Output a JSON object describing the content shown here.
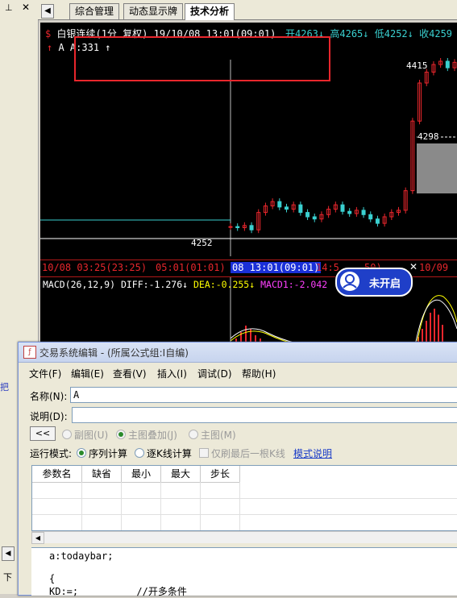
{
  "left_panel": {
    "pin_icon": "pin-icon",
    "close_label": "✕",
    "partial_char": "把",
    "arrow_label": "◀",
    "partial_char2": "下"
  },
  "tabs": {
    "nav_label": "◀",
    "items": [
      {
        "label": "综合管理"
      },
      {
        "label": "动态显示牌"
      },
      {
        "label": "技术分析"
      }
    ]
  },
  "chart": {
    "title_icon": "$",
    "title": "白银连续(1分 复权) 19/10/08 13:01(09:01)",
    "open": "开4263",
    "high": "高4265",
    "low": "低4252",
    "close": "收4259",
    "indicator_line": "A A:331",
    "price_high": "4415",
    "price_cross": "4298",
    "price_low": "4252",
    "time_labels": [
      "10/08 03:25(23:25)",
      "05:01(01:01)",
      "08 13:01(09:01)",
      "14:5",
      "50)",
      "10/09"
    ],
    "macd_line": {
      "name": "MACD(26,12,9)",
      "diff": "DIFF:-1.276",
      "dea": "DEA:-0.255",
      "macd": "MACD1:-2.042"
    },
    "colors": {
      "up": "#e8262c",
      "down": "#3ad0d0",
      "diff": "#ffffff",
      "dea": "#ffff00",
      "macd": "#ff40ff"
    }
  },
  "chart_data": {
    "type": "line",
    "title": "白银连续(1分 复权)",
    "series": [
      {
        "name": "",
        "values": [
          4263,
          4262,
          4264,
          4260,
          4276,
          4282,
          4286,
          4281,
          4279,
          4283,
          4276,
          4272,
          4270,
          4274,
          4279,
          4283,
          4277,
          4275,
          4278,
          4274,
          4270,
          4266,
          4272,
          4276,
          4278,
          4296,
          4360,
          4395,
          4405,
          4412,
          4415,
          4409,
          4414
        ]
      }
    ],
    "ylim": [
      4252,
      4415
    ]
  },
  "badge": {
    "label": "未开启",
    "icon": "user-icon"
  },
  "dialog": {
    "icon": "formula-icon",
    "title": "交易系统编辑 - (所属公式组:I自编)",
    "menu": [
      "文件(F)",
      "编辑(E)",
      "查看(V)",
      "插入(I)",
      "调试(D)",
      "帮助(H)"
    ],
    "name_label": "名称(N):",
    "name_value": "A",
    "desc_label": "说明(D):",
    "desc_value": "",
    "collapse_label": "<<",
    "overlay_options": [
      "副图(U)",
      "主图叠加(J)",
      "主图(M)"
    ],
    "run_mode_label": "运行模式:",
    "run_options": [
      "序列计算",
      "逐K线计算"
    ],
    "refresh_label": "仅刷最后一根K线",
    "mode_help_link": "模式说明",
    "param_headers": [
      "参数名",
      "缺省",
      "最小",
      "最大",
      "步长"
    ],
    "code_lines": [
      "a:todaybar;",
      "",
      "{",
      "KD:=;          //开多条件"
    ]
  }
}
